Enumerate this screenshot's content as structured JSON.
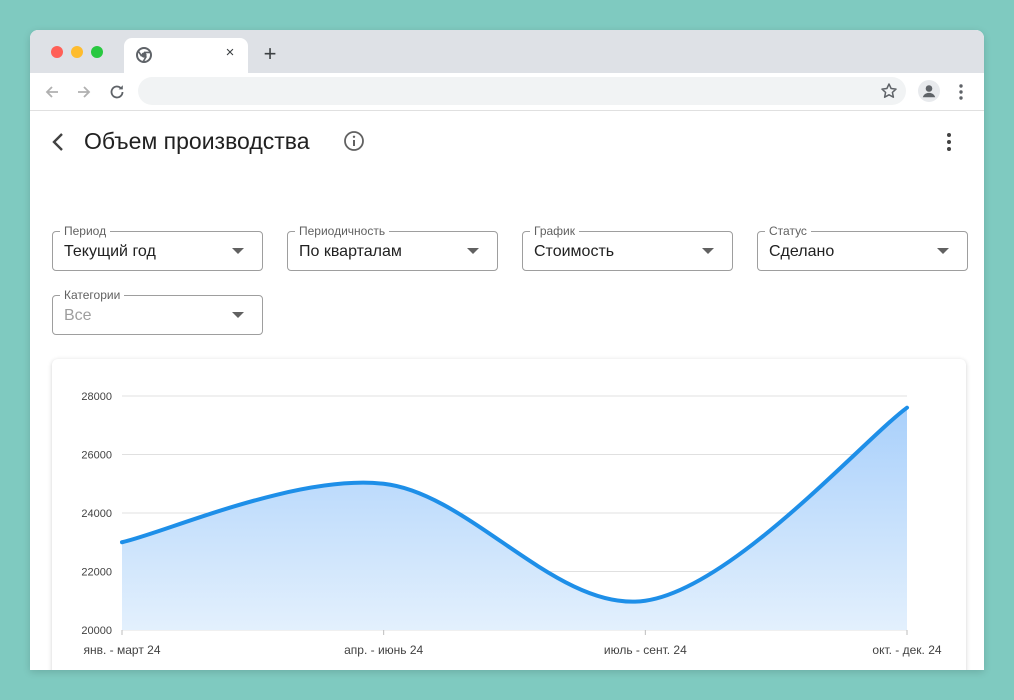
{
  "browser": {
    "tab_close": "×",
    "new_tab": "+"
  },
  "page": {
    "title": "Объем производства"
  },
  "filters": [
    {
      "label": "Период",
      "value": "Текущий год",
      "placeholder": false
    },
    {
      "label": "Периодичность",
      "value": "По кварталам",
      "placeholder": false
    },
    {
      "label": "График",
      "value": "Стоимость",
      "placeholder": false
    },
    {
      "label": "Статус",
      "value": "Сделано",
      "placeholder": false
    },
    {
      "label": "Категории",
      "value": "Все",
      "placeholder": true
    }
  ],
  "icons": {
    "back": "chevron-left-icon",
    "info": "info-icon",
    "more": "more-vert-icon",
    "dropdown": "arrow-drop-down-icon"
  },
  "colors": {
    "line": "#1e8fe8",
    "fill_top": "#a9d0fb",
    "fill_bottom": "#e3f0fd",
    "grid": "#e0e0e0",
    "background": "#7fcac0"
  },
  "chart_data": {
    "type": "area",
    "categories": [
      "янв. - март 24",
      "апр. - июнь 24",
      "июль - сент. 24",
      "окт. - дек. 24"
    ],
    "values": [
      23000,
      25000,
      21000,
      27600
    ],
    "ylim": [
      20000,
      28000
    ],
    "yticks": [
      20000,
      22000,
      24000,
      26000,
      28000
    ],
    "grid": true,
    "smooth": true
  }
}
